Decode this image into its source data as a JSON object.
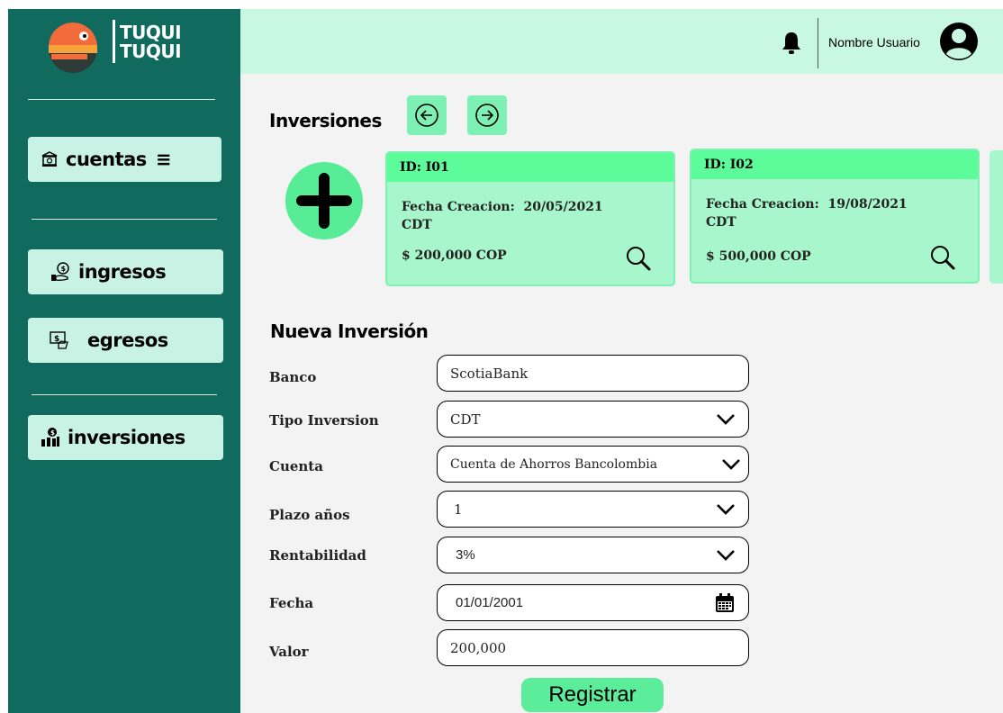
{
  "app": {
    "logo_line1": "TUQUI",
    "logo_line2": "TUQUI"
  },
  "colors": {
    "sidebar": "#106b5e",
    "topbar": "#c8f7e2",
    "accent": "#5cfc9a",
    "card": "#a8f7cc"
  },
  "sidebar": {
    "items": [
      {
        "label": "cuentas",
        "icon": "bank-icon",
        "suffix": "≡"
      },
      {
        "label": "ingresos",
        "icon": "money-hand-icon"
      },
      {
        "label": "egresos",
        "icon": "bill-hand-icon"
      },
      {
        "label": "inversiones",
        "icon": "investment-icon"
      }
    ]
  },
  "topbar": {
    "user_name": "Nombre Usuario",
    "bell_icon": "bell-icon",
    "avatar_icon": "user-avatar-icon"
  },
  "investments": {
    "title": "Inversiones",
    "cards": [
      {
        "id": "ID: I01",
        "fecha_label": "Fecha Creacion:",
        "fecha": "20/05/2021",
        "tipo": "CDT",
        "valor": "$ 200,000 COP"
      },
      {
        "id": "ID: I02",
        "fecha_label": "Fecha Creacion:",
        "fecha": "19/08/2021",
        "tipo": "CDT",
        "valor": "$ 500,000 COP"
      }
    ]
  },
  "form": {
    "title": "Nueva Inversión",
    "fields": [
      {
        "label": "Banco",
        "value": "ScotiaBank"
      },
      {
        "label": "Tipo Inversion",
        "value": "CDT"
      },
      {
        "label": "Cuenta",
        "value": "Cuenta de Ahorros Bancolombia"
      },
      {
        "label": "Plazo años",
        "value": "1"
      },
      {
        "label": "Rentabilidad",
        "value": "3%"
      },
      {
        "label": "Fecha",
        "value": "01/01/2001"
      },
      {
        "label": "Valor",
        "value": "200,000"
      }
    ],
    "submit_label": "Registrar"
  }
}
